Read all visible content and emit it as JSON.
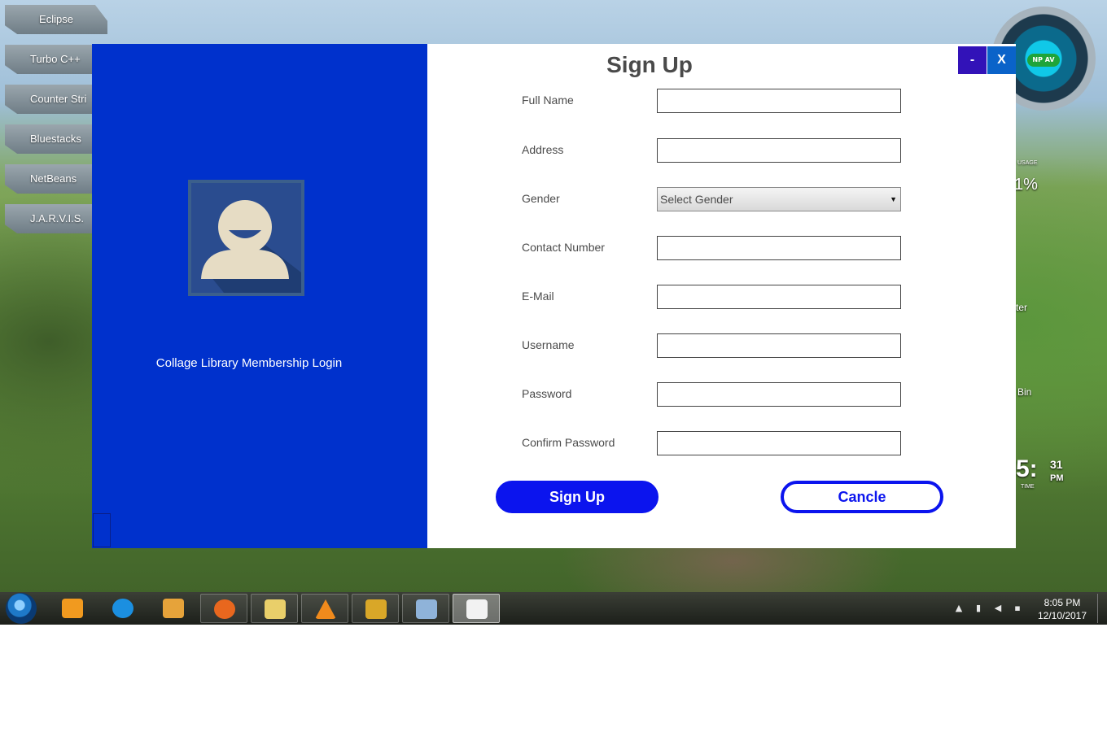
{
  "desktop": {
    "shortcuts": [
      {
        "label": "Eclipse"
      },
      {
        "label": "Turbo C++"
      },
      {
        "label": "Counter Stri"
      },
      {
        "label": "Bluestacks"
      },
      {
        "label": "NetBeans"
      },
      {
        "label": "J.A.R.V.I.S."
      }
    ],
    "gadget": {
      "badge": "NP AV"
    },
    "sidebar_text": {
      "usage_label": "USAGE",
      "usage_value": "1%",
      "icon1_label": "ter",
      "icon2_label": "Bin",
      "clock_digits": "5:",
      "clock_digits_small": "31",
      "clock_ampm": "PM",
      "clock_label": "TIME"
    }
  },
  "dialog": {
    "left": {
      "avatar_icon": "user-avatar-icon",
      "caption": "Collage Library Membership Login"
    },
    "title": "Sign Up",
    "window_controls": {
      "minimize": "-",
      "close": "X"
    },
    "fields": {
      "full_name": {
        "label": "Full Name",
        "value": ""
      },
      "address": {
        "label": "Address",
        "value": ""
      },
      "gender": {
        "label": "Gender",
        "selected": "Select Gender"
      },
      "contact": {
        "label": "Contact Number",
        "value": ""
      },
      "email": {
        "label": "E-Mail",
        "value": ""
      },
      "username": {
        "label": "Username",
        "value": ""
      },
      "password": {
        "label": "Password",
        "value": ""
      },
      "confirm_password": {
        "label": "Confirm Password",
        "value": ""
      }
    },
    "buttons": {
      "signup": "Sign Up",
      "cancel": "Cancle"
    },
    "colors": {
      "panel_blue": "#0031cc",
      "button_blue": "#0b14ee",
      "minimize_bg": "#3212b8",
      "close_bg": "#0a63c9"
    }
  },
  "taskbar": {
    "apps": [
      "windows-media-player-icon",
      "internet-explorer-icon",
      "word-icon",
      "firefox-icon",
      "file-explorer-icon",
      "vlc-icon",
      "winamp-icon",
      "virtualbox-icon",
      "java-icon"
    ],
    "time": "8:05 PM",
    "date": "12/10/2017"
  }
}
